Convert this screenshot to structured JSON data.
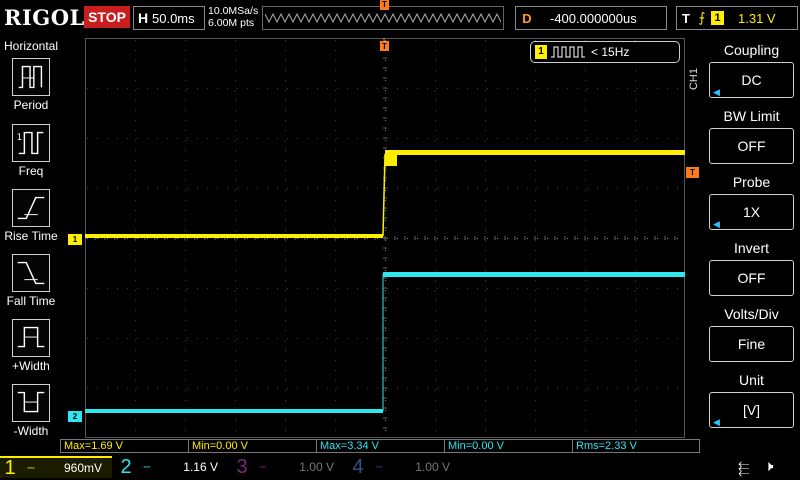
{
  "brand": "RIGOL",
  "run_state": "STOP",
  "timebase": {
    "letter": "H",
    "value": "50.0ms"
  },
  "sample": {
    "rate": "10.0MSa/s",
    "points": "6.00M pts"
  },
  "delay": {
    "letter": "D",
    "value": "-400.000000us"
  },
  "trigger": {
    "letter": "T",
    "edge_icon": "rising-edge-icon",
    "source": "1",
    "level": "1.31 V"
  },
  "trigger_marker": "T",
  "left_menu": {
    "title": "Horizontal",
    "items": [
      {
        "label": "Period",
        "icon": "period-icon"
      },
      {
        "label": "Freq",
        "icon": "freq-icon"
      },
      {
        "label": "Rise Time",
        "icon": "rise-time-icon"
      },
      {
        "label": "Fall Time",
        "icon": "fall-time-icon"
      },
      {
        "label": "+Width",
        "icon": "positive-width-icon"
      },
      {
        "label": "-Width",
        "icon": "negative-width-icon"
      }
    ]
  },
  "freq_counter": {
    "channel": "1",
    "value": "< 15Hz"
  },
  "right_menu": {
    "channel_label": "CH1",
    "items": [
      {
        "title": "Coupling",
        "value": "DC"
      },
      {
        "title": "BW Limit",
        "value": "OFF"
      },
      {
        "title": "Probe",
        "value": "1X"
      },
      {
        "title": "Invert",
        "value": "OFF"
      },
      {
        "title": "Volts/Div",
        "value": "Fine"
      },
      {
        "title": "Unit",
        "value": "[V]"
      }
    ]
  },
  "measurements": [
    {
      "text": "Max=1.69 V",
      "color": "yellow"
    },
    {
      "text": "Min=0.00 V",
      "color": "yellow"
    },
    {
      "text": "Max=3.34 V",
      "color": "cyan"
    },
    {
      "text": "Min=0.00 V",
      "color": "cyan"
    },
    {
      "text": "Rms=2.33 V",
      "color": "cyan"
    }
  ],
  "channels": [
    {
      "num": "1",
      "coupling": "DC",
      "scale": "960mV",
      "color": "#ffee00"
    },
    {
      "num": "2",
      "coupling": "DC",
      "scale": "1.16 V",
      "color": "#2ee6f0"
    },
    {
      "num": "3",
      "coupling": "DC",
      "scale": "1.00 V",
      "color": "#7a2a7a"
    },
    {
      "num": "4",
      "coupling": "DC",
      "scale": "1.00 V",
      "color": "#35508a"
    }
  ],
  "trace_markers": {
    "ch1": "1",
    "ch2": "2",
    "trig_level": "T"
  },
  "colors": {
    "ch1": "#ffee00",
    "ch2": "#2ee6f0",
    "stop": "#c81e1e",
    "trigger": "#ff7a1a"
  }
}
